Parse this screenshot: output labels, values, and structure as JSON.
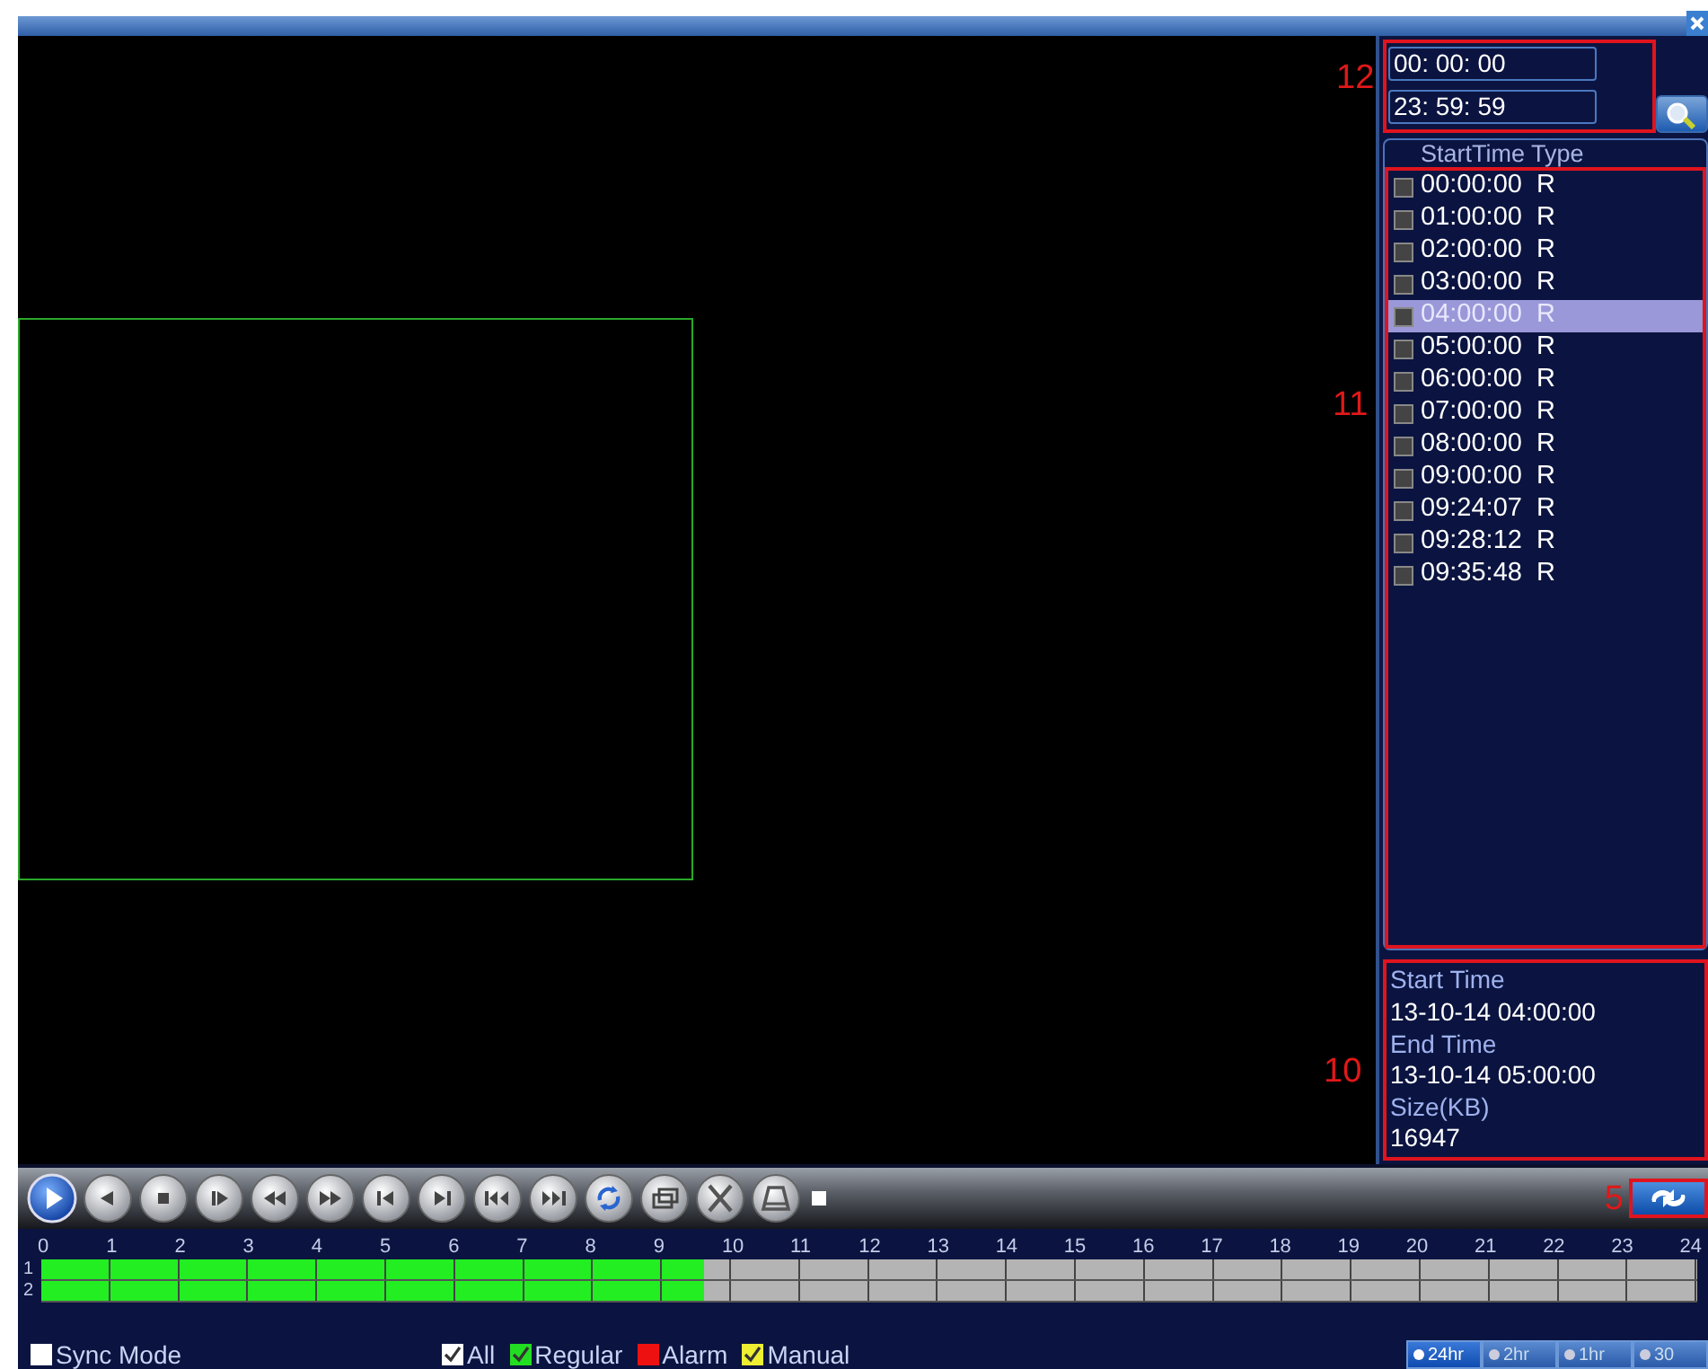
{
  "time_range": {
    "callout": "12",
    "start": "00: 00: 00",
    "end": "23: 59: 59"
  },
  "file_list": {
    "callout": "11",
    "header": "StartTime Type",
    "files": [
      {
        "time": "00:00:00",
        "type": "R",
        "checked": false,
        "selected": false
      },
      {
        "time": "01:00:00",
        "type": "R",
        "checked": false,
        "selected": false
      },
      {
        "time": "02:00:00",
        "type": "R",
        "checked": false,
        "selected": false
      },
      {
        "time": "03:00:00",
        "type": "R",
        "checked": false,
        "selected": false
      },
      {
        "time": "04:00:00",
        "type": "R",
        "checked": false,
        "selected": true
      },
      {
        "time": "05:00:00",
        "type": "R",
        "checked": false,
        "selected": false
      },
      {
        "time": "06:00:00",
        "type": "R",
        "checked": false,
        "selected": false
      },
      {
        "time": "07:00:00",
        "type": "R",
        "checked": false,
        "selected": false
      },
      {
        "time": "08:00:00",
        "type": "R",
        "checked": false,
        "selected": false
      },
      {
        "time": "09:00:00",
        "type": "R",
        "checked": false,
        "selected": false
      },
      {
        "time": "09:24:07",
        "type": "R",
        "checked": false,
        "selected": false
      },
      {
        "time": "09:28:12",
        "type": "R",
        "checked": false,
        "selected": false
      },
      {
        "time": "09:35:48",
        "type": "R",
        "checked": false,
        "selected": false
      }
    ]
  },
  "file_info": {
    "callout": "10",
    "fields": [
      {
        "label": "Start Time",
        "value": "13-10-14 04:00:00"
      },
      {
        "label": "End Time",
        "value": "13-10-14 05:00:00"
      },
      {
        "label": "Size(KB)",
        "value": "16947"
      }
    ]
  },
  "switch_button": {
    "callout": "5"
  },
  "timeline": {
    "hours": [
      "0",
      "1",
      "2",
      "3",
      "4",
      "5",
      "6",
      "7",
      "8",
      "9",
      "10",
      "11",
      "12",
      "13",
      "14",
      "15",
      "16",
      "17",
      "18",
      "19",
      "20",
      "21",
      "22",
      "23",
      "24"
    ],
    "channels": [
      {
        "label": "1",
        "level": 0.4
      },
      {
        "label": "2",
        "level": 0.4
      }
    ]
  },
  "sync_mode": {
    "label": "Sync Mode",
    "checked": false
  },
  "filters": [
    {
      "label": "All",
      "checked": true,
      "color": "#ffffff"
    },
    {
      "label": "Regular",
      "checked": true,
      "color": "#22dd22"
    },
    {
      "label": "Alarm",
      "checked": false,
      "color": "#ee1111"
    },
    {
      "label": "Manual",
      "checked": true,
      "color": "#eeee33"
    }
  ],
  "zoom_options": [
    {
      "label": "24hr",
      "selected": true
    },
    {
      "label": "2hr",
      "selected": false
    },
    {
      "label": "1hr",
      "selected": false
    },
    {
      "label": "30",
      "selected": false
    }
  ]
}
